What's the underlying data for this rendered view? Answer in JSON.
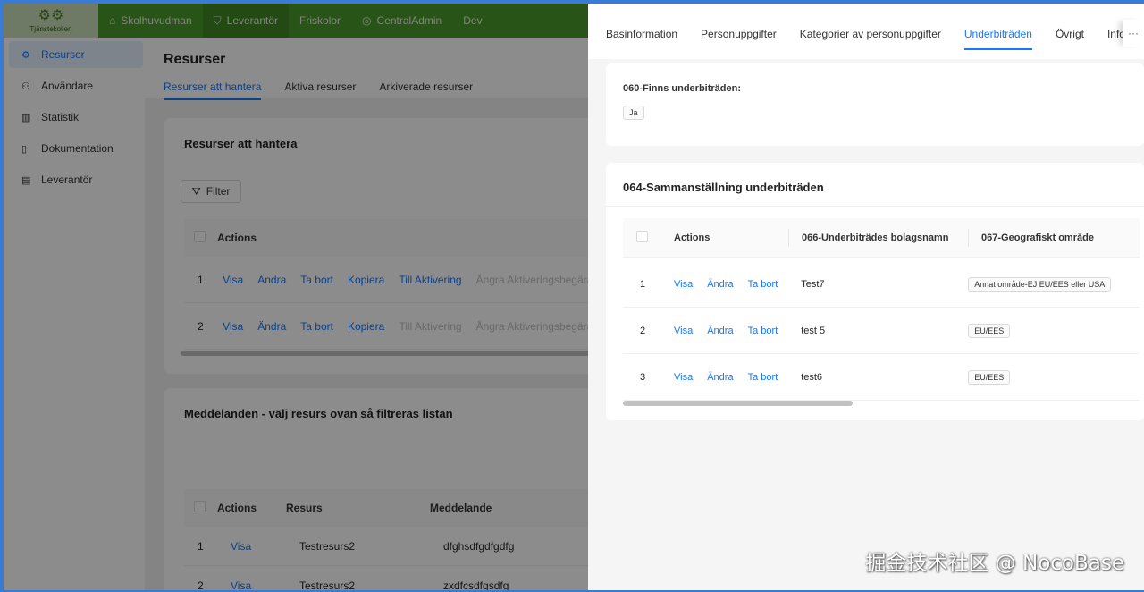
{
  "app": {
    "logo_text": "Tjänstekollen",
    "top_nav": [
      {
        "label": "Skolhuvudman",
        "icon": "building-icon"
      },
      {
        "label": "Leverantör",
        "icon": "shield-icon"
      },
      {
        "label": "Friskolor",
        "icon": ""
      },
      {
        "label": "CentralAdmin",
        "icon": "globe-icon"
      },
      {
        "label": "Dev",
        "icon": ""
      }
    ]
  },
  "sidebar": {
    "items": [
      {
        "label": "Resurser",
        "icon": "settings-icon"
      },
      {
        "label": "Användare",
        "icon": "users-icon"
      },
      {
        "label": "Statistik",
        "icon": "chart-icon"
      },
      {
        "label": "Dokumentation",
        "icon": "document-icon"
      },
      {
        "label": "Leverantör",
        "icon": "form-icon"
      }
    ]
  },
  "main": {
    "title": "Resurser",
    "tabs": [
      "Resurser att hantera",
      "Aktiva resurser",
      "Arkiverade resurser"
    ],
    "card1": {
      "title": "Resurser att hantera",
      "filter_label": "Filter",
      "actions_header": "Actions",
      "rows": [
        {
          "index": "1",
          "actions": [
            "Visa",
            "Ändra",
            "Ta bort",
            "Kopiera",
            "Till Aktivering",
            "Ångra Aktiveringsbegäran"
          ]
        },
        {
          "index": "2",
          "actions": [
            "Visa",
            "Ändra",
            "Ta bort",
            "Kopiera",
            "Till Aktivering",
            "Ångra Aktiveringsbegäran"
          ]
        }
      ]
    },
    "card2": {
      "title": "Meddelanden - välj resurs ovan så filtreras listan",
      "headers": [
        "Actions",
        "Resurs",
        "Meddelande"
      ],
      "rows": [
        {
          "index": "1",
          "action": "Visa",
          "resurs": "Testresurs2",
          "meddelande": "dfghsdfgdfgdfg"
        },
        {
          "index": "2",
          "action": "Visa",
          "resurs": "Testresurs2",
          "meddelande": "zxdfcsdfgsdfg"
        }
      ]
    }
  },
  "drawer": {
    "tabs": [
      "Basinformation",
      "Personuppgifter",
      "Kategorier av personuppgifter",
      "Underbiträden",
      "Övrigt",
      "Infoversi"
    ],
    "more": "···",
    "section1": {
      "field_label": "060-Finns underbiträden:",
      "value": "Ja"
    },
    "section2": {
      "title": "064-Sammanställning underbiträden",
      "headers": [
        "Actions",
        "066-Underbiträdes bolagsnamn",
        "067-Geografiskt område"
      ],
      "actions": [
        "Visa",
        "Ändra",
        "Ta bort"
      ],
      "rows": [
        {
          "index": "1",
          "name": "Test7",
          "area": "Annat område-EJ EU/EES eller USA"
        },
        {
          "index": "2",
          "name": "test 5",
          "area": "EU/EES"
        },
        {
          "index": "3",
          "name": "test6",
          "area": "EU/EES"
        }
      ]
    }
  },
  "watermark": "掘金技术社区 @ NocoBase"
}
